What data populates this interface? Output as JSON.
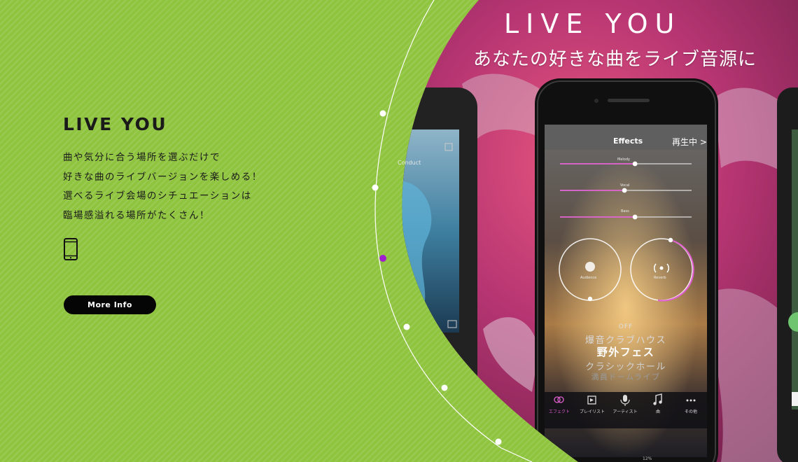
{
  "feature": {
    "title": "LIVE YOU",
    "description": [
      "曲や気分に合う場所を選ぶだけで",
      "好きな曲のライブバージョンを楽しめる！",
      "選べるライブ会場のシチュエーションは",
      "臨場感溢れる場所がたくさん！"
    ],
    "more_button": "More Info"
  },
  "visual": {
    "banner_title": "LIVE YOU",
    "banner_subtitle": "あなたの好きな曲をライブ音源に",
    "screen": {
      "header_title": "Effects",
      "now_playing": "再生中 >",
      "sliders": [
        {
          "label": "Melody",
          "level": 0.57
        },
        {
          "label": "Vocal",
          "level": 0.49
        },
        {
          "label": "Bass",
          "level": 0.57
        }
      ],
      "dials": [
        {
          "label": "Audience"
        },
        {
          "label": "Reverb"
        }
      ],
      "venue_list": {
        "off": "OFF",
        "items": [
          "爆音クラブハウス",
          "野外フェス",
          "クラシックホール",
          "満員ドームライブ"
        ],
        "selected": "野外フェス"
      },
      "tabs": [
        "エフェクト",
        "プレイリスト",
        "アーティスト",
        "曲",
        "その他"
      ],
      "left_screen_text": "Conduct",
      "bottom_text": "12%"
    }
  },
  "colors": {
    "background": "#8fc43f",
    "button_bg": "#050505",
    "accent_dot": "#a020d0",
    "slider_accent": "#e060d0"
  }
}
